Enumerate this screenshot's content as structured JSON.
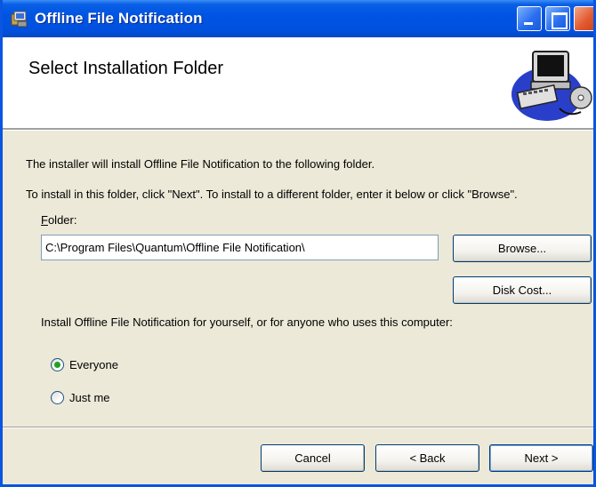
{
  "window": {
    "title": "Offline File Notification"
  },
  "header": {
    "title": "Select Installation Folder"
  },
  "body": {
    "line1": "The installer will install Offline File Notification to the following folder.",
    "line2": "To install in this folder, click \"Next\". To install to a different folder, enter it below or click \"Browse\".",
    "folder_label_accel": "F",
    "folder_label_rest": "older:",
    "folder_value": "C:\\Program Files\\Quantum\\Offline File Notification\\",
    "browse_label": "Browse...",
    "disk_cost_label": "Disk Cost...",
    "install_for_text": "Install Offline File Notification for yourself, or for anyone who uses this computer:",
    "options": [
      {
        "label": "Everyone",
        "selected": true
      },
      {
        "label": "Just me",
        "selected": false
      }
    ]
  },
  "footer": {
    "cancel_label": "Cancel",
    "back_label": "< Back",
    "next_label": "Next >"
  },
  "colors": {
    "titlebar": "#0054e3",
    "dialog_bg": "#ece9d8",
    "radio_dot": "#21a121"
  },
  "icons": {
    "title": "installer-package-icon",
    "header_art": "computer-setup-icon"
  }
}
